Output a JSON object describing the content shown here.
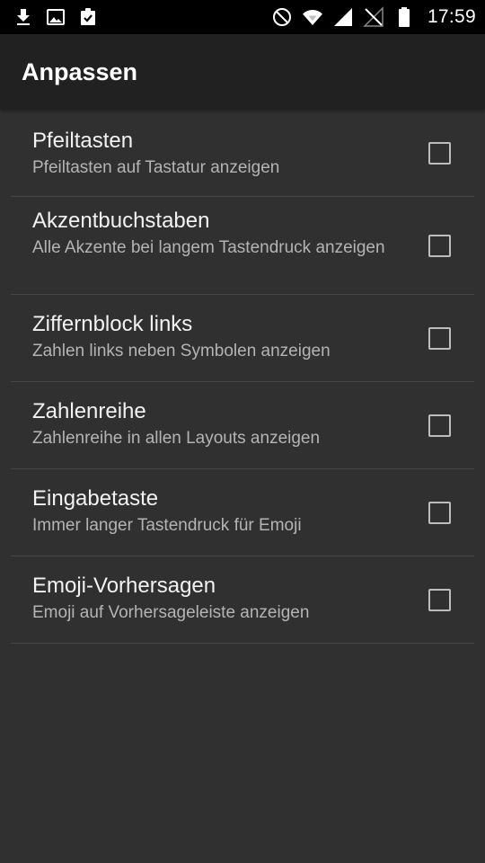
{
  "status_bar": {
    "time": "17:59",
    "left_icons": [
      "download-icon",
      "image-icon",
      "clipboard-check-icon"
    ],
    "right_icons": [
      "do-not-disturb-icon",
      "wifi-icon",
      "signal-icon",
      "no-sim-icon",
      "battery-icon"
    ]
  },
  "app_bar": {
    "title": "Anpassen"
  },
  "settings": [
    {
      "title": "Pfeiltasten",
      "summary": "Pfeiltasten auf Tastatur anzeigen",
      "checked": false
    },
    {
      "title": "Akzentbuchstaben",
      "summary": "Alle Akzente bei langem Tastendruck anzeigen",
      "checked": false
    },
    {
      "title": "Ziffernblock links",
      "summary": "Zahlen links neben Symbolen anzeigen",
      "checked": false
    },
    {
      "title": "Zahlenreihe",
      "summary": "Zahlenreihe in allen Layouts anzeigen",
      "checked": false
    },
    {
      "title": "Eingabetaste",
      "summary": "Immer langer Tastendruck für Emoji",
      "checked": false
    },
    {
      "title": "Emoji-Vorhersagen",
      "summary": "Emoji auf Vorhersageleiste anzeigen",
      "checked": false
    }
  ],
  "colors": {
    "background": "#303030",
    "app_bar": "#212121",
    "status_bar": "#000000",
    "divider": "#454545"
  }
}
